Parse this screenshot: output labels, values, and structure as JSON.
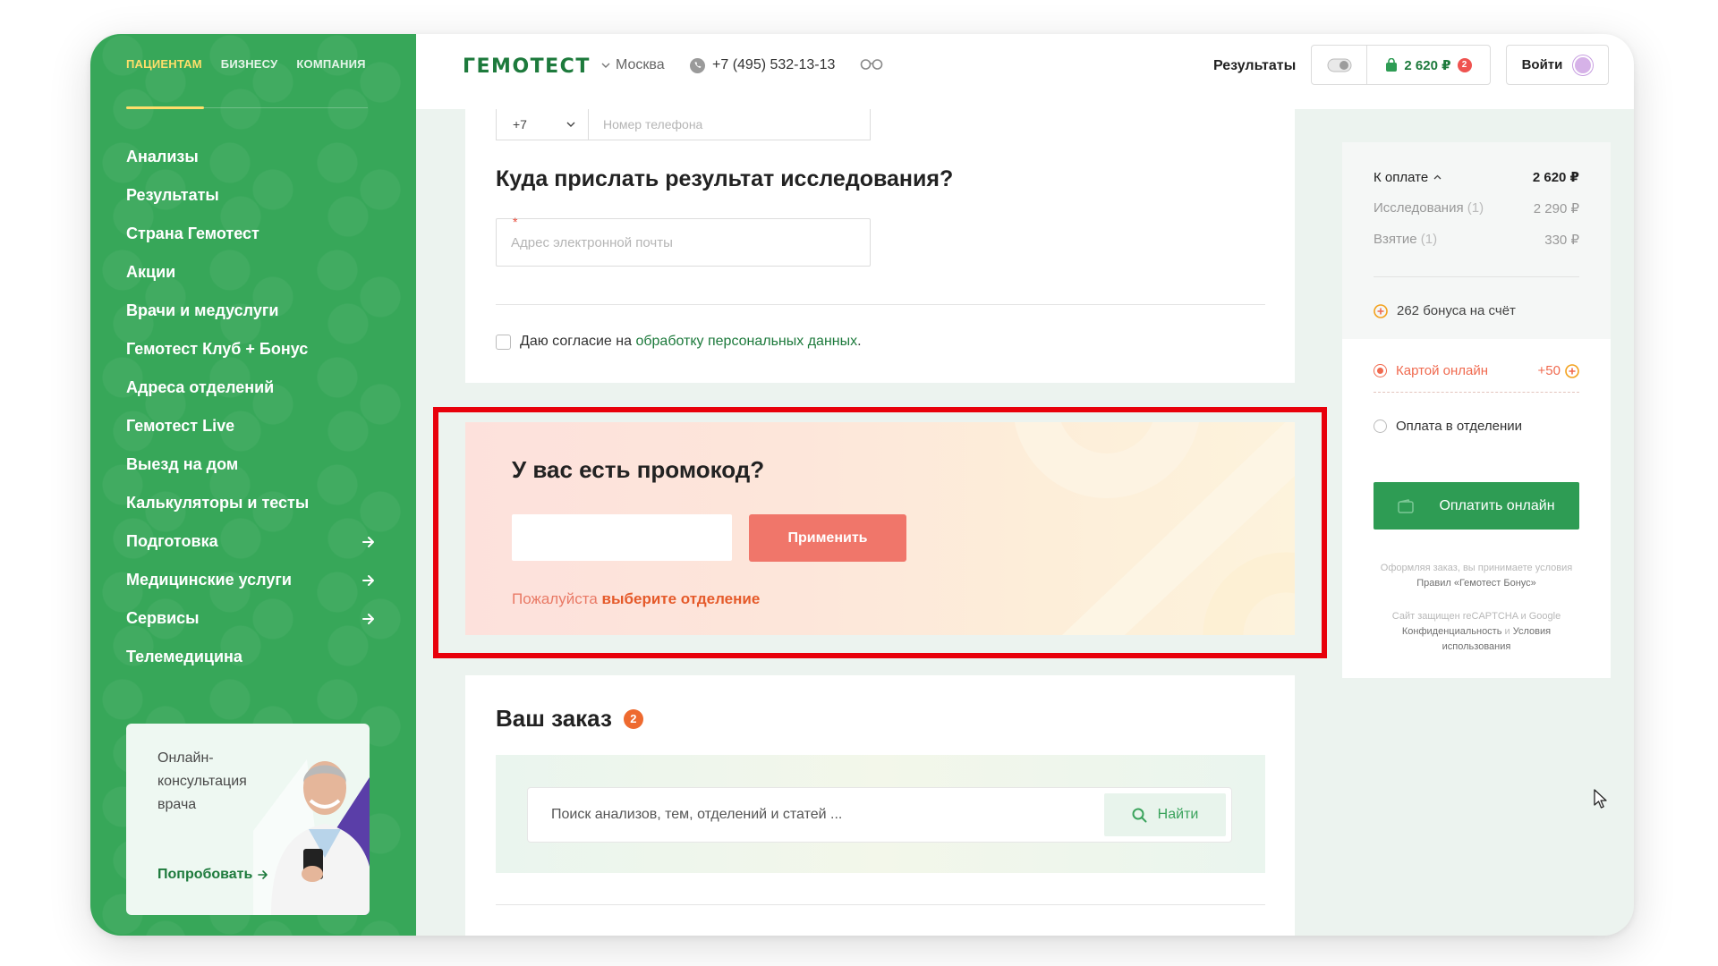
{
  "sidebar": {
    "tabs": [
      {
        "label": "ПАЦИЕНТАМ",
        "active": true
      },
      {
        "label": "БИЗНЕСУ",
        "active": false
      },
      {
        "label": "КОМПАНИЯ",
        "active": false
      }
    ],
    "menu": [
      {
        "label": "Анализы"
      },
      {
        "label": "Результаты"
      },
      {
        "label": "Страна Гемотест"
      },
      {
        "label": "Акции"
      },
      {
        "label": "Врачи и медуслуги"
      },
      {
        "label": "Гемотест Клуб + Бонус"
      },
      {
        "label": "Адреса отделений"
      },
      {
        "label": "Гемотест Live"
      },
      {
        "label": "Выезд на дом"
      },
      {
        "label": "Калькуляторы и тесты"
      },
      {
        "label": "Подготовка",
        "arrow": true
      },
      {
        "label": "Медицинские услуги",
        "arrow": true
      },
      {
        "label": "Сервисы",
        "arrow": true
      },
      {
        "label": "Телемедицина"
      }
    ],
    "promo_card": {
      "text": "Онлайн-консультация врача",
      "link": "Попробовать"
    }
  },
  "header": {
    "logo": "ГЕМОТЕСТ",
    "city": "Москва",
    "phone": "+7 (495) 532-13-13",
    "results": "Результаты",
    "cart_total": "2 620 ₽",
    "cart_count": "2",
    "login": "Войти"
  },
  "form": {
    "phone_code": "+7",
    "phone_placeholder": "Номер телефона",
    "result_title": "Куда прислать результат исследования?",
    "email_required_mark": "*",
    "email_placeholder": "Адрес электронной почты",
    "consent_text": "Даю согласие на",
    "consent_link": "обработку персональных данных",
    "consent_end": "."
  },
  "promo": {
    "title": "У вас есть промокод?",
    "input_value": "",
    "apply": "Применить",
    "hint_prefix": "Пожалуйста",
    "hint_link": "выберите отделение"
  },
  "order": {
    "title": "Ваш заказ",
    "count": "2",
    "search_placeholder": "Поиск анализов, тем, отделений и статей ...",
    "search_button": "Найти"
  },
  "summary": {
    "to_pay_label": "К оплате",
    "to_pay_value": "2 620 ₽",
    "studies_label": "Исследования",
    "studies_count": "(1)",
    "studies_value": "2 290 ₽",
    "sampling_label": "Взятие",
    "sampling_count": "(1)",
    "sampling_value": "330 ₽",
    "bonus": "262 бонуса на счёт",
    "pay_card": "Картой онлайн",
    "pay_card_bonus": "+50",
    "pay_branch": "Оплата в отделении",
    "pay_button": "Оплатить онлайн",
    "fine_1a": "Оформляя заказ, вы принимаете условия",
    "fine_1b": "Правил «Гемотест Бонус»",
    "fine_2a": "Сайт защищен reCAPTCHA и Google",
    "fine_2b": "Конфиденциальность",
    "fine_2c": "и",
    "fine_2d": "Условия использования"
  },
  "colors": {
    "brand_green": "#37a759",
    "dark_green": "#1d7a3c",
    "accent_yellow": "#ffde6a",
    "promo_button": "#f0766a",
    "highlight_red": "#e8000b"
  }
}
